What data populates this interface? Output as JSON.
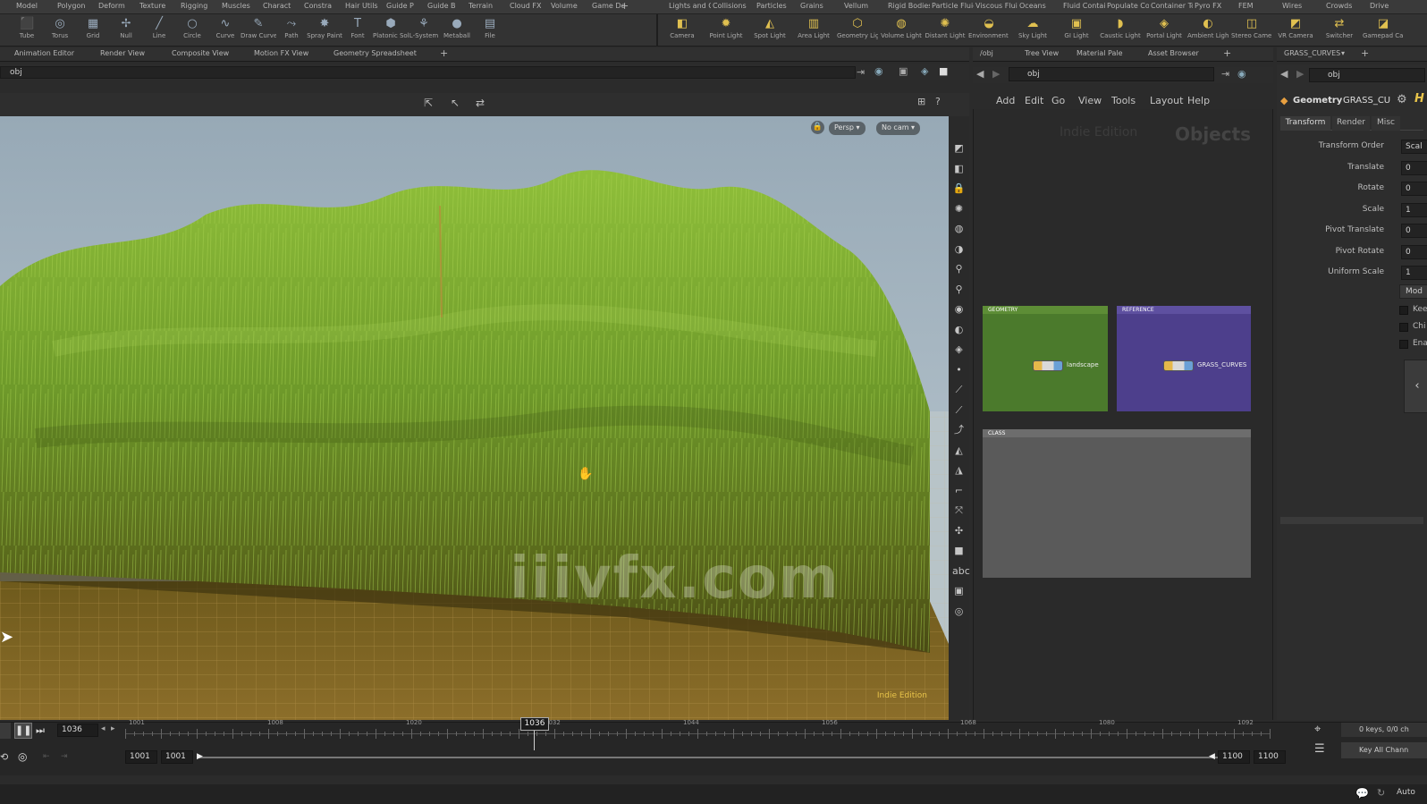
{
  "shelf_tabs_left": [
    "Model",
    "Polygon",
    "Deform",
    "Texture",
    "Rigging",
    "Muscles",
    "Charact",
    "Constra",
    "Hair Utils",
    "Guide P",
    "Guide B",
    "Terrain",
    "Cloud FX",
    "Volume",
    "Game De"
  ],
  "shelf_tabs_right": [
    "Lights and C",
    "Collisions",
    "Particles",
    "Grains",
    "Vellum",
    "Rigid Bodies",
    "Particle Fluids",
    "Viscous Fluids",
    "Oceans",
    "Fluid Contai",
    "Populate Con",
    "Container Tools",
    "Pyro FX",
    "FEM",
    "Wires",
    "Crowds",
    "Drive"
  ],
  "tools_left": [
    {
      "label": "Tube",
      "icon": "⬛"
    },
    {
      "label": "Torus",
      "icon": "◎"
    },
    {
      "label": "Grid",
      "icon": "▦"
    },
    {
      "label": "Null",
      "icon": "✢"
    },
    {
      "label": "Line",
      "icon": "╱"
    },
    {
      "label": "Circle",
      "icon": "○"
    },
    {
      "label": "Curve",
      "icon": "∿"
    },
    {
      "label": "Draw Curve",
      "icon": "✎"
    },
    {
      "label": "Path",
      "icon": "⤳"
    },
    {
      "label": "Spray Paint",
      "icon": "✸"
    },
    {
      "label": "Font",
      "icon": "T"
    },
    {
      "label": "Platonic Solids",
      "icon": "⬢"
    },
    {
      "label": "L-System",
      "icon": "⚘"
    },
    {
      "label": "Metaball",
      "icon": "●"
    },
    {
      "label": "File",
      "icon": "▤"
    }
  ],
  "tools_right": [
    {
      "label": "Camera",
      "icon": "◧"
    },
    {
      "label": "Point Light",
      "icon": "✹"
    },
    {
      "label": "Spot Light",
      "icon": "◭"
    },
    {
      "label": "Area Light",
      "icon": "▥"
    },
    {
      "label": "Geometry Light",
      "icon": "⬡"
    },
    {
      "label": "Volume Light",
      "icon": "◍"
    },
    {
      "label": "Distant Light",
      "icon": "✺"
    },
    {
      "label": "Environment Light",
      "icon": "◒"
    },
    {
      "label": "Sky Light",
      "icon": "☁"
    },
    {
      "label": "GI Light",
      "icon": "▣"
    },
    {
      "label": "Caustic Light",
      "icon": "◗"
    },
    {
      "label": "Portal Light",
      "icon": "◈"
    },
    {
      "label": "Ambient Light",
      "icon": "◐"
    },
    {
      "label": "Stereo Camera",
      "icon": "◫"
    },
    {
      "label": "VR Camera",
      "icon": "◩"
    },
    {
      "label": "Switcher",
      "icon": "⇄"
    },
    {
      "label": "Gamepad Camera",
      "icon": "◪"
    }
  ],
  "pane_tabs": [
    "Animation Editor",
    "Render View",
    "Composite View",
    "Motion FX View",
    "Geometry Spreadsheet"
  ],
  "viewport": {
    "path": "obj",
    "persp_label": "Persp ▾",
    "cam_label": "No cam ▾",
    "indie_label": "Indie Edition",
    "watermark": "iiivfx.com"
  },
  "network": {
    "tabs": [
      "/obj",
      "Tree View",
      "Material Pale",
      "Asset Browser"
    ],
    "path": "obj",
    "menu": [
      "Add",
      "Edit",
      "Go",
      "View",
      "Tools",
      "Layout",
      "Help"
    ],
    "watermark_left": "Indie Edition",
    "watermark_right": "Objects",
    "boxes": [
      {
        "title": "GEOMETRY",
        "node_label": "landscape",
        "color": "#4b7a2c"
      },
      {
        "title": "REFERENCE",
        "node_label": "GRASS_CURVES",
        "color": "#4d3f8c"
      },
      {
        "title": "CLASS",
        "node_label": "",
        "color": "#5a5a5a"
      }
    ]
  },
  "params": {
    "tab": "GRASS_CURVES",
    "path": "obj",
    "node_type": "Geometry",
    "node_name": "GRASS_CU",
    "subtabs": [
      "Transform",
      "Render",
      "Misc"
    ],
    "rows": [
      {
        "label": "Transform Order",
        "value": "Scal"
      },
      {
        "label": "Translate",
        "value": "0"
      },
      {
        "label": "Rotate",
        "value": "0"
      },
      {
        "label": "Scale",
        "value": "1"
      },
      {
        "label": "Pivot Translate",
        "value": "0"
      },
      {
        "label": "Pivot Rotate",
        "value": "0"
      },
      {
        "label": "Uniform Scale",
        "value": "1"
      }
    ],
    "mod_button": "Mod",
    "checks": [
      "Kee",
      "Chi",
      "Ena"
    ]
  },
  "timeline": {
    "current_frame": "1036",
    "marker_frame": "1036",
    "ticks": [
      "1001",
      "1008",
      "1020",
      "1032",
      "1044",
      "1056",
      "1068",
      "1080",
      "1092"
    ],
    "range_start": "1001",
    "range_start2": "1001",
    "range_end": "1100",
    "range_end2": "1100",
    "keys_label": "0 keys, 0/0 ch",
    "key_all_label": "Key All Chann",
    "auto_label": "Auto"
  }
}
